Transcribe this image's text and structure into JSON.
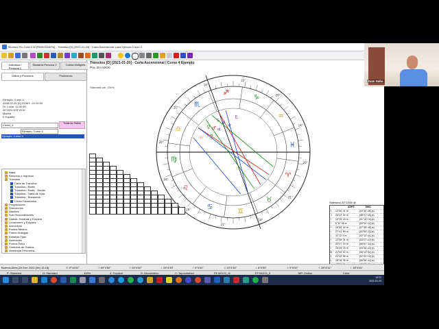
{
  "window": {
    "title": "Morinus Pro Gold 8.02 [RMS/2016/PA] - Tránsitos [D] [2021-01-20] - Carta Ascensional, para Ejemplo Curso 4"
  },
  "left_panel": {
    "tabs_top": [
      "Individual / Persona 1",
      "Sinastría Persona 2",
      "Cartas Múltiples"
    ],
    "tabs_sub": [
      "Datos y Procesos",
      "Posiciones"
    ],
    "info_lines": [
      "Ejemplo, Curso 4",
      "2008-02-25 [D]  DGMT: -01:00:00",
      "Hr. Local: 12:00:00",
      "40°25'N 003°40'W",
      "Madrid",
      "E.España"
    ],
    "course_select": "Curso_4",
    "search_value": "Ejemplo, Curso 4",
    "todas_label": "Todas las Tablas",
    "selected_item": "Ejemplo, Curso 4",
    "tree_items": [
      "Natal",
      "Retornos e Ingresos",
      "Tránsitos",
      "Carta de Tránsitos",
      "Tránsitos / Radix",
      "Tránsitos / Radix - Radial",
      "Tránsitos - Tabla de Vida",
      "Tránsitos - Búsqueda",
      "Ciclos Planetarios",
      "Progresiones",
      "Direcciones",
      "Ataches",
      "Sub-Personalidades",
      "Diarias, Horarias y Electiva",
      "Lunaciones y Eclipses",
      "Armónicos",
      "Puntos Medios",
      "Partes Arábigas",
      "Estrellas Fijas",
      "Asteroides",
      "Puntos Extra",
      "Símbolos de Grados",
      "Astrología Draconica"
    ],
    "analysis_button": "Análisis de Eventos - Activar"
  },
  "chart": {
    "title": "Tránsitos [D] [2021-01-20] - Carta Ascensional | Curso 4 Ejemplo",
    "subtitle": "Pos. En ADOD",
    "standard_label": "Standard orb, 100%",
    "degree_labels": [
      "20°",
      "21°",
      "14°",
      "21°",
      "20°",
      "14°",
      "20°",
      "21°",
      "14°",
      "22°",
      "20°",
      "14°"
    ],
    "aspect_table_header": "Sideriano 20°13'55 @",
    "aspect_columns": [
      "ASPS",
      "DMC"
    ],
    "aspect_rows": [
      [
        "☉",
        "10°30' 41 m",
        "[04°46' 05] (s)"
      ],
      [
        "☽",
        "26°22' 00 m",
        "[08°21' 15] (s)"
      ],
      [
        "☿",
        "19°25' 15 m",
        "[01°14' 10] (s)"
      ],
      [
        "♀",
        "0°12' 55 m",
        "[03°53' 12] (s)"
      ],
      [
        "♂",
        "26°53' 42 m",
        "[07°38' 45] (s)"
      ],
      [
        "♃",
        "27°41' 59 m",
        "[02°55' 22] (s)"
      ],
      [
        "♄",
        "11°12' 0 m",
        "[02°12' 41] (s)"
      ],
      [
        "♅",
        "12°06' 31 m",
        "[03°27' 42] (s)"
      ],
      [
        "♆",
        "29°27' 00 m",
        "[06°51' 44] (s)"
      ],
      [
        "♇",
        "25°25' 15 m",
        "[04°36' 43] (s)"
      ],
      [
        "☊",
        "21°34' 02 m",
        "[06°13' 52] (s)"
      ],
      [
        "⚷",
        "20°25' 55 m",
        "[02°22' 13] (s)"
      ],
      [
        "⚸",
        "28°16' 35 m",
        "[06°58' 44] (s)"
      ],
      [
        "⊗",
        "12°51' 01 m",
        "[05°39' 30] (s)"
      ]
    ]
  },
  "status_bar": {
    "datetime": "Buenos Aires [20 Ene 2021 (Ve) 13:16]",
    "positions": [
      "☉ 0°16'02\"",
      "☽ 09°4'50\"",
      "☿ 26°4'52\"",
      "♀ 25°4'33\"",
      "♂ 5°4'02\"",
      "♃ 13°4'35\"",
      "♄ 8°4'53\"",
      "♅ 5°5'02\"",
      "♆ 28°4'31\"",
      "♇ 18°4'01\""
    ],
    "modes": [
      "P: Standard",
      "O: Standard",
      "100%",
      "Z: Tropical",
      "S: Geocéntrico",
      "C: Topocéntrico",
      "FE NGCS_11",
      "FP NGCS_3",
      "MP: Zodiac",
      "Color"
    ]
  },
  "taskbar": {
    "time": "13:21",
    "date": "2021-01-20",
    "lang": "ES"
  },
  "webcam": {
    "name": "Juan Saba"
  },
  "colors": {
    "accent_blue": "#2a52be",
    "taskbar": "#1c2b4a",
    "aspect_red": "#d01818",
    "aspect_blue": "#1a3fd0",
    "aspect_green": "#128a12"
  }
}
